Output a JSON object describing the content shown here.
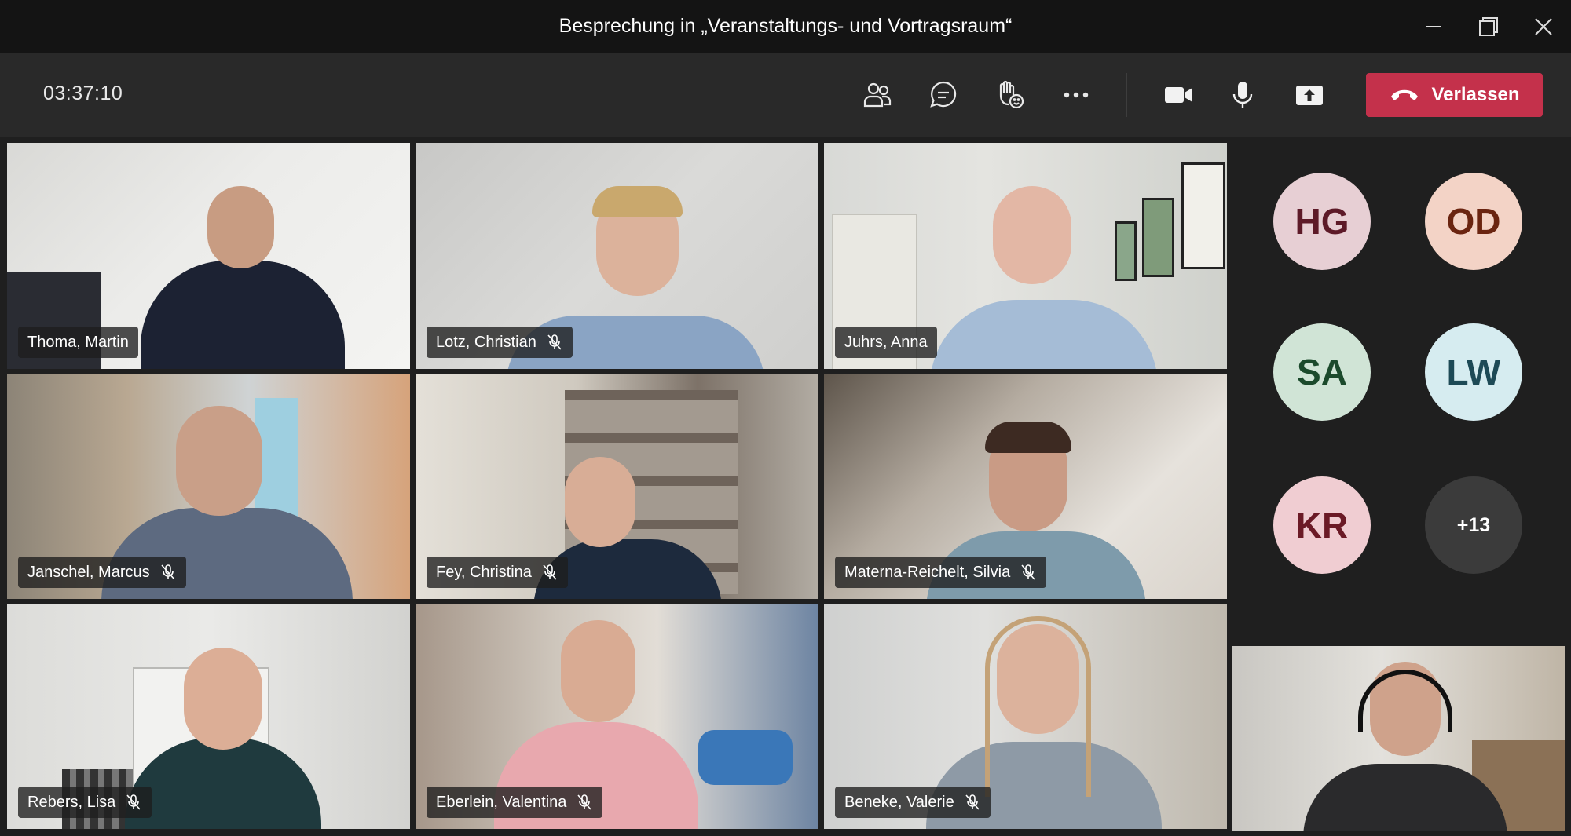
{
  "window": {
    "title": "Besprechung in „Veranstaltungs- und Vortragsraum“"
  },
  "toolbar": {
    "timer": "03:37:10",
    "leave_label": "Verlassen",
    "leave_color": "#c4314b",
    "icons": [
      "participants-icon",
      "chat-icon",
      "raise-hand-icon",
      "more-options-icon",
      "camera-icon",
      "microphone-icon",
      "share-screen-icon"
    ]
  },
  "participants": [
    {
      "name": "Thoma, Martin",
      "muted": false
    },
    {
      "name": "Lotz, Christian",
      "muted": true
    },
    {
      "name": "Juhrs, Anna",
      "muted": false
    },
    {
      "name": "Janschel, Marcus",
      "muted": true
    },
    {
      "name": "Fey, Christina",
      "muted": true
    },
    {
      "name": "Materna-Reichelt, Silvia",
      "muted": true
    },
    {
      "name": "Rebers, Lisa",
      "muted": true
    },
    {
      "name": "Eberlein, Valentina",
      "muted": true
    },
    {
      "name": "Beneke, Valerie",
      "muted": true
    }
  ],
  "avatars": [
    {
      "initials": "HG",
      "bg": "#e7cfd4",
      "fg": "#5d1a28"
    },
    {
      "initials": "OD",
      "bg": "#f3d3c6",
      "fg": "#6a2410"
    },
    {
      "initials": "SA",
      "bg": "#d0e4d6",
      "fg": "#1b4a2c"
    },
    {
      "initials": "LW",
      "bg": "#d6ecf0",
      "fg": "#1d4a56"
    },
    {
      "initials": "KR",
      "bg": "#f0cdd2",
      "fg": "#6b1a26"
    }
  ],
  "overflow": {
    "label": "+13"
  }
}
